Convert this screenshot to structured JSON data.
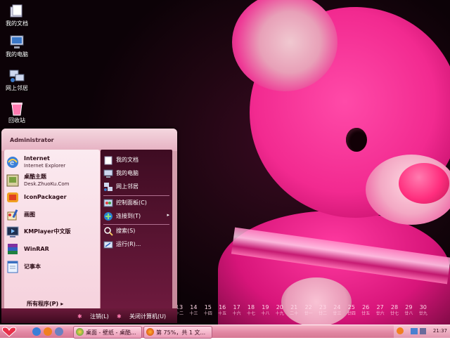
{
  "desktop": {
    "icons": [
      {
        "label": "我的文档",
        "icon": "folder-icon"
      },
      {
        "label": "我的电脑",
        "icon": "computer-icon"
      },
      {
        "label": "网上邻居",
        "icon": "network-icon"
      },
      {
        "label": "回收站",
        "icon": "recycle-bin-icon"
      }
    ]
  },
  "calendar": {
    "days": [
      {
        "n": "13",
        "s": "十二"
      },
      {
        "n": "14",
        "s": "十三"
      },
      {
        "n": "15",
        "s": "十四"
      },
      {
        "n": "16",
        "s": "十五"
      },
      {
        "n": "17",
        "s": "十六"
      },
      {
        "n": "18",
        "s": "十七"
      },
      {
        "n": "19",
        "s": "十八"
      },
      {
        "n": "20",
        "s": "十九"
      },
      {
        "n": "21",
        "s": "二十"
      },
      {
        "n": "22",
        "s": "廿一"
      },
      {
        "n": "23",
        "s": "廿二"
      },
      {
        "n": "24",
        "s": "廿三"
      },
      {
        "n": "25",
        "s": "廿四"
      },
      {
        "n": "26",
        "s": "廿五"
      },
      {
        "n": "27",
        "s": "廿六"
      },
      {
        "n": "28",
        "s": "廿七"
      },
      {
        "n": "29",
        "s": "廿八"
      },
      {
        "n": "30",
        "s": "廿九"
      }
    ]
  },
  "start_menu": {
    "user": "Administrator",
    "left_items": [
      {
        "title": "Internet",
        "subtitle": "Internet Explorer",
        "icon": "ie-icon"
      },
      {
        "title": "桌酷主题",
        "subtitle": "Desk.ZhuoKu.Com",
        "icon": "theme-icon"
      },
      {
        "title": "IconPackager",
        "icon": "iconpackager-icon"
      },
      {
        "title": "画图",
        "icon": "paint-icon"
      },
      {
        "title": "KMPlayer中文版",
        "icon": "kmplayer-icon"
      },
      {
        "title": "WinRAR",
        "icon": "winrar-icon"
      },
      {
        "title": "记事本",
        "icon": "notepad-icon"
      }
    ],
    "all_programs": "所有程序(P)",
    "right_items": [
      {
        "label": "我的文档",
        "icon": "folder-icon"
      },
      {
        "label": "我的电脑",
        "icon": "computer-icon"
      },
      {
        "label": "网上邻居",
        "icon": "network-icon"
      },
      {
        "label": "控制面板(C)",
        "icon": "control-panel-icon"
      },
      {
        "label": "连接到(T)",
        "icon": "connect-icon",
        "arrow": "▸"
      },
      {
        "label": "搜索(S)",
        "icon": "search-icon"
      },
      {
        "label": "运行(R)...",
        "icon": "run-icon"
      }
    ],
    "footer": {
      "logoff": "注销(L)",
      "shutdown": "关闭计算机(U)"
    }
  },
  "taskbar": {
    "tasks": [
      {
        "label": "桌面 - 壁纸 - 桌酷...",
        "icon": "browser-icon"
      },
      {
        "label": "第 75%，共 1 文...",
        "icon": "firefox-icon"
      }
    ],
    "clock": "21:37"
  },
  "colors": {
    "accent": "#f22a90",
    "taskbar": "#e48aa6"
  }
}
